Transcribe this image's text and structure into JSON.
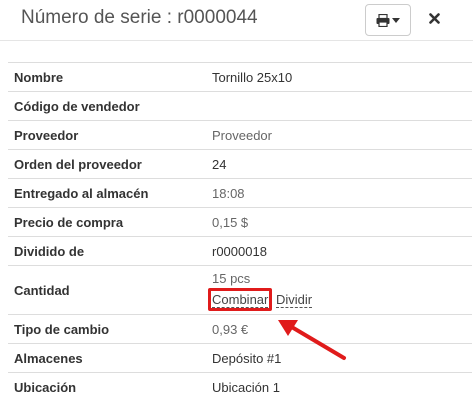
{
  "header": {
    "title": "Número de serie : r0000044",
    "print_icon": "printer-icon",
    "caret_icon": "caret-down-icon",
    "close_icon": "close-icon"
  },
  "details": [
    {
      "label": "Nombre",
      "value": "Tornillo 25x10"
    },
    {
      "label": "Código de vendedor",
      "value": ""
    },
    {
      "label": "Proveedor",
      "value": "Proveedor"
    },
    {
      "label": "Orden del proveedor",
      "value": "24"
    },
    {
      "label": "Entregado al almacén",
      "value": "18:08"
    },
    {
      "label": "Precio de compra",
      "value": "0,15 $"
    },
    {
      "label": "Dividido de",
      "value": "r0000018"
    },
    {
      "label": "Cantidad",
      "value": "15 pcs",
      "actions": [
        "Combinar",
        "Dividir"
      ]
    },
    {
      "label": "Tipo de cambio",
      "value": "0,93 €"
    },
    {
      "label": "Almacenes",
      "value": "Depósito #1"
    },
    {
      "label": "Ubicación",
      "value": "Ubicación 1"
    }
  ],
  "annotation": {
    "highlight_color": "#e01b1b",
    "highlighted_action": "Combinar"
  }
}
